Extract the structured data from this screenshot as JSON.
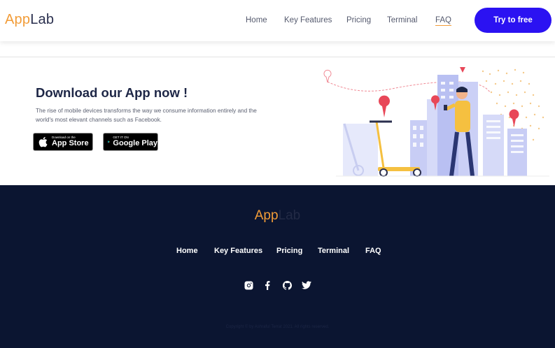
{
  "brand": {
    "part1": "App",
    "part2": "Lab"
  },
  "nav": {
    "items": [
      "Home",
      "Key Features",
      "Pricing",
      "Terminal",
      "FAQ"
    ]
  },
  "cta": {
    "label": "Try to free"
  },
  "download": {
    "title": "Download our App now !",
    "description": "The rise of mobile devices transforms the way we consume information entirely and the world's most elevant channels such as Facebook.",
    "appstore": {
      "small": "Download on the",
      "big": "App Store"
    },
    "googleplay": {
      "small": "GET IT ON",
      "big": "Google Play"
    }
  },
  "footer": {
    "brand": {
      "part1": "App",
      "part2": "Lab"
    },
    "nav": [
      "Home",
      "Key Features",
      "Pricing",
      "Terminal",
      "FAQ"
    ],
    "social": [
      "instagram-icon",
      "facebook-icon",
      "github-icon",
      "twitter-icon"
    ],
    "copyright": "Copyright © by Ashraful Terrat 2021. All rights reserved."
  },
  "colors": {
    "accent": "#f29c38",
    "primary": "#2b12f2",
    "footer_bg": "#0b1531",
    "heading": "#1d2646"
  }
}
